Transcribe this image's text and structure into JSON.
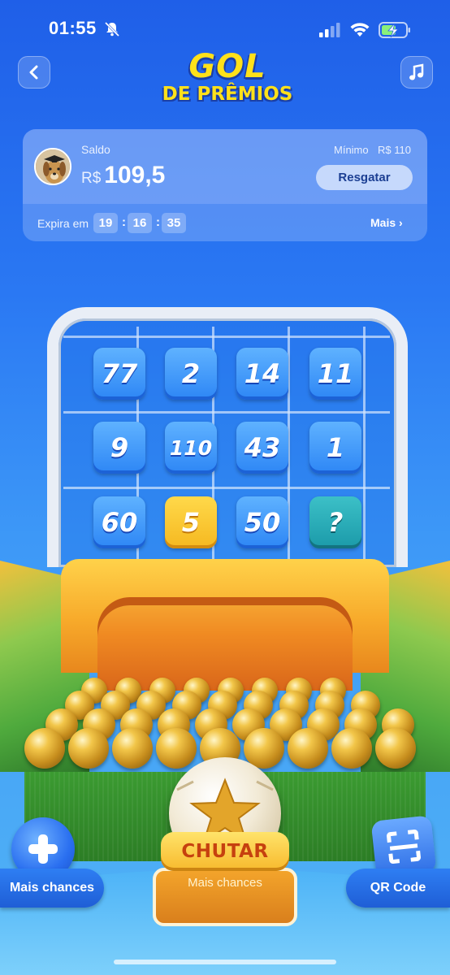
{
  "status_bar": {
    "time": "01:55"
  },
  "header": {
    "logo_line1": "GOL",
    "logo_line2": "DE PRÊMIOS"
  },
  "balance": {
    "saldo_label": "Saldo",
    "currency": "R$",
    "amount": "109,5",
    "minimum_label": "Mínimo",
    "minimum_value": "R$ 110",
    "redeem_button": "Resgatar",
    "expires_label": "Expira em",
    "timer": {
      "hours": "19",
      "minutes": "16",
      "seconds": "35"
    },
    "more_link": "Mais ›"
  },
  "board": {
    "rows": [
      [
        "77",
        "2",
        "14",
        "11"
      ],
      [
        "9",
        "110",
        "43",
        "1"
      ],
      [
        "60",
        "5",
        "50",
        "?"
      ]
    ],
    "selected": "5"
  },
  "actions": {
    "more_chances_left": "Mais chances",
    "kick_button": "CHUTAR",
    "kick_sub": "Mais chances",
    "qr_button": "QR Code"
  }
}
